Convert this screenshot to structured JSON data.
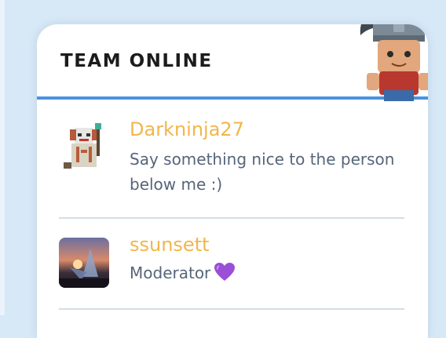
{
  "widget": {
    "title": "TEAM ONLINE"
  },
  "feed": [
    {
      "username": "Darkninja27",
      "message": "Say something nice to the person below me :)",
      "avatar_icon": "pixel-clown-avatar"
    },
    {
      "username": "ssunsett",
      "message": "Moderator",
      "badge_icon": "purple-heart-icon",
      "avatar_icon": "butterfly-sunset-avatar"
    }
  ],
  "colors": {
    "username": "#f2b64a",
    "message": "#56657a",
    "accent_bar": "#4a93e0",
    "background": "#d7e8f7"
  }
}
